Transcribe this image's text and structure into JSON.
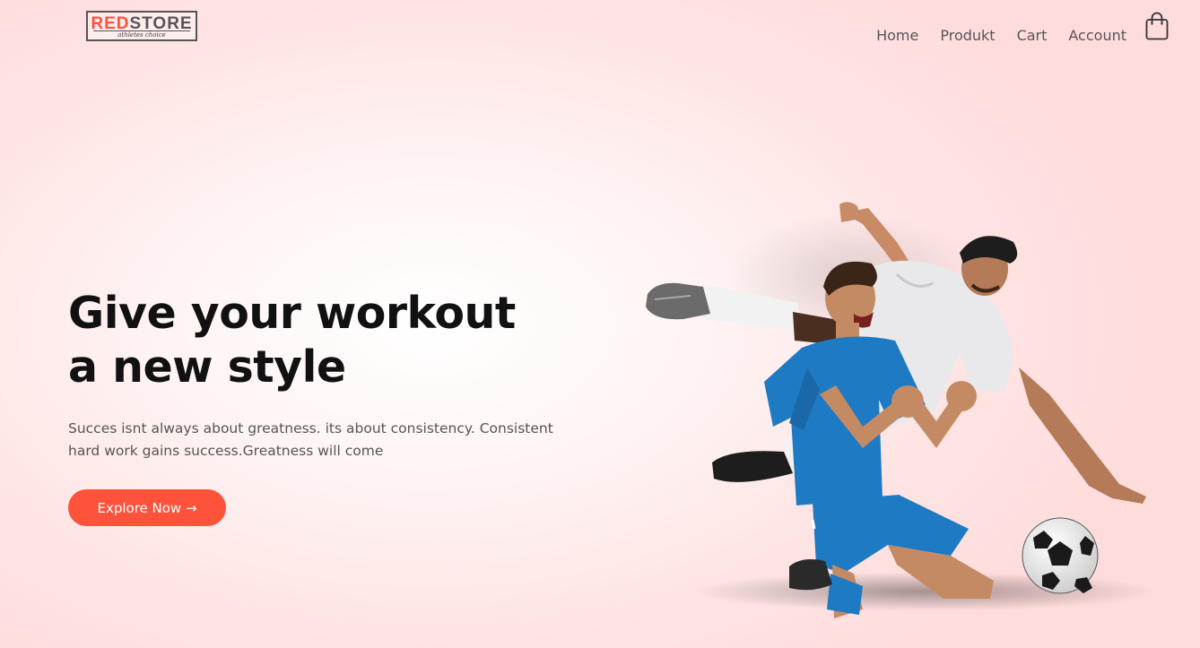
{
  "brand": {
    "logo_red": "RED",
    "logo_dark": "STORE",
    "tagline": "athletes choice"
  },
  "nav": {
    "items": [
      "Home",
      "Produkt",
      "Cart",
      "Account"
    ],
    "cart_icon": "shopping-bag-icon"
  },
  "hero": {
    "title_line1": "Give your workout",
    "title_line2": "a new style",
    "text": "Succes isnt always about greatness. its about consistency. Consistent hard work gains success.Greatness will come",
    "button_label": "Explore Now →",
    "image": "soccer-players-image"
  },
  "colors": {
    "accent": "#ff523b",
    "background": "#ffe4e4",
    "heading": "#111111",
    "body_text": "#555555"
  }
}
